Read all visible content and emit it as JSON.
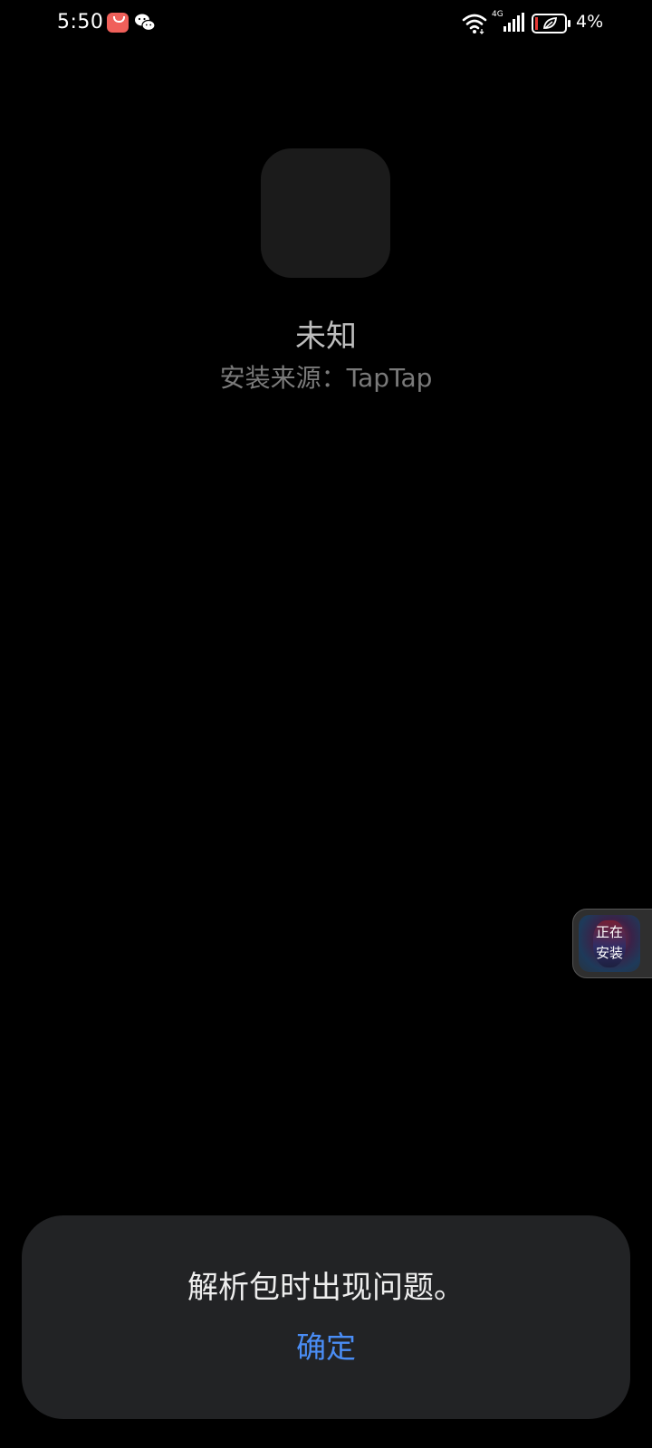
{
  "status_bar": {
    "time": "5:50",
    "network_type": "4G",
    "battery_percent": "4%",
    "notification_icons": [
      "huawei-appgallery-icon",
      "wechat-icon"
    ]
  },
  "app": {
    "name": "未知",
    "install_source": "安装来源：TapTap"
  },
  "floating_bubble": {
    "label_line1": "正在",
    "label_line2": "安装"
  },
  "dialog": {
    "message": "解析包时出现问题。",
    "confirm_label": "确定"
  },
  "colors": {
    "background": "#000000",
    "dialog_background": "#222325",
    "accent": "#4a8df5"
  }
}
